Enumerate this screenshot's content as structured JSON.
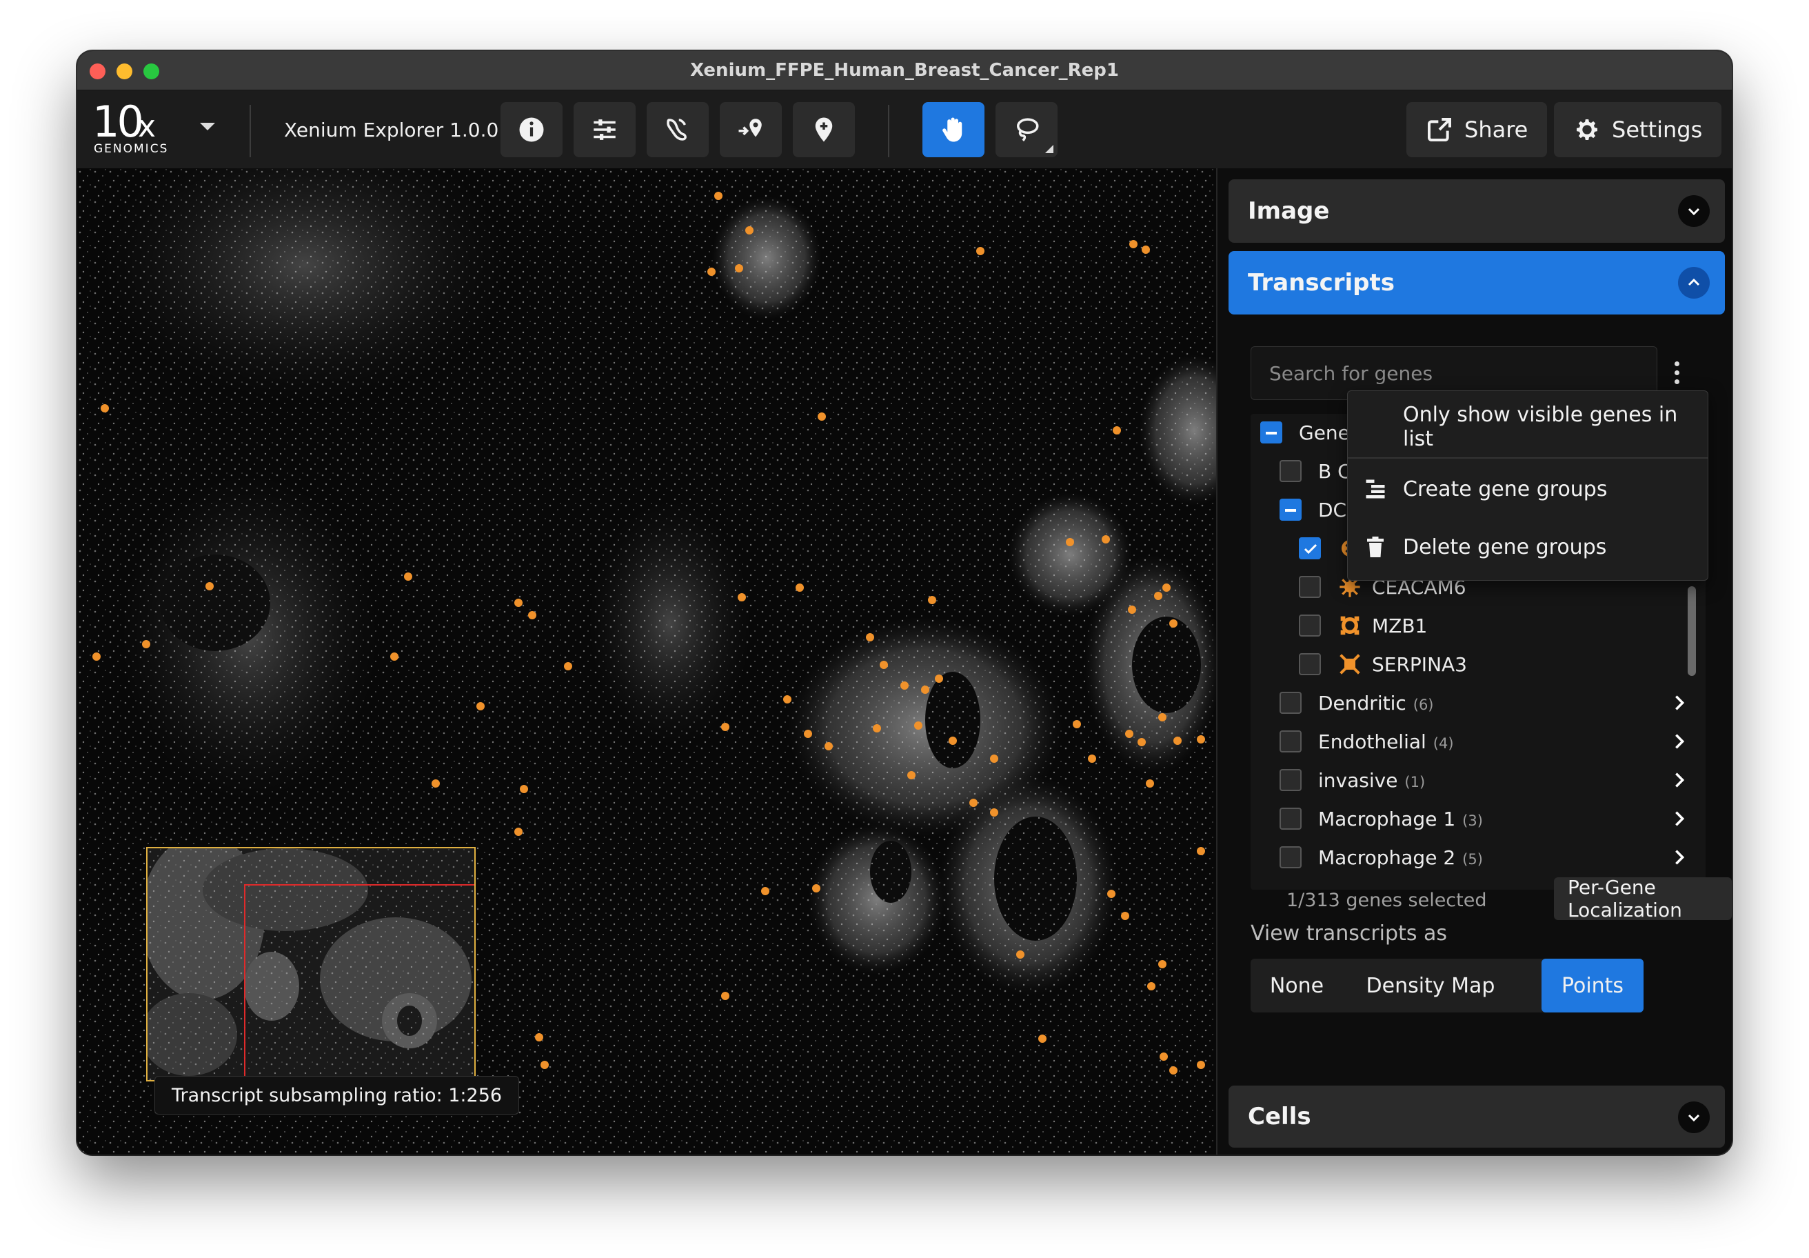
{
  "window": {
    "title": "Xenium_FFPE_Human_Breast_Cancer_Rep1"
  },
  "toolbar": {
    "logo_main": "10",
    "logo_x": "x",
    "logo_sub": "GENOMICS",
    "app_name": "Xenium Explorer 1.0.0",
    "share_label": "Share",
    "settings_label": "Settings"
  },
  "viewer": {
    "subsampling_text": "Transcript subsampling ratio: 1:256"
  },
  "panel": {
    "image_label": "Image",
    "transcripts_label": "Transcripts",
    "cells_label": "Cells",
    "search_placeholder": "Search for genes",
    "genes_root_label": "Genes",
    "rows": [
      {
        "label": "B Ce",
        "count": ""
      },
      {
        "label": "DCIS",
        "count": ""
      },
      {
        "label": "",
        "count": ""
      },
      {
        "label": "CEACAM6",
        "count": ""
      },
      {
        "label": "MZB1",
        "count": ""
      },
      {
        "label": "SERPINA3",
        "count": ""
      },
      {
        "label": "Dendritic",
        "count": "(6)"
      },
      {
        "label": "Endothelial",
        "count": "(4)"
      },
      {
        "label": "invasive",
        "count": "(1)"
      },
      {
        "label": "Macrophage 1",
        "count": "(3)"
      },
      {
        "label": "Macrophage 2",
        "count": "(5)"
      }
    ],
    "selected_count": "1/313 genes selected",
    "per_gene_label": "Per-Gene Localization",
    "view_as_label": "View transcripts as",
    "view_options": [
      "None",
      "Density Map",
      "Points"
    ],
    "view_selected": "Points"
  },
  "dropdown": {
    "items": [
      "Only show visible genes in list",
      "Create gene groups",
      "Delete gene groups"
    ]
  },
  "colors": {
    "accent": "#1f78e0",
    "marker": "#f0922b"
  }
}
